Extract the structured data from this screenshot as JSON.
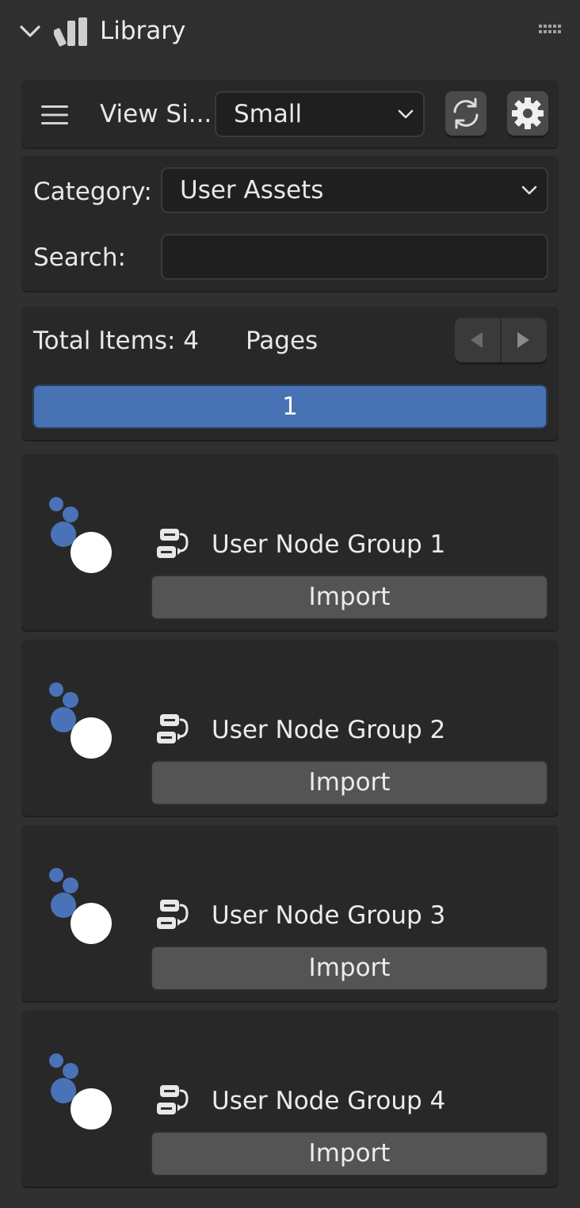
{
  "panel": {
    "title": "Library"
  },
  "toolbar": {
    "view_size_label": "View Si...",
    "view_size_value": "Small"
  },
  "filters": {
    "category_label": "Category:",
    "category_value": "User Assets",
    "search_label": "Search:",
    "search_value": ""
  },
  "pagination": {
    "total_label": "Total Items: 4",
    "pages_label": "Pages",
    "current_page": "1"
  },
  "items": [
    {
      "name": "User Node Group 1",
      "import_label": "Import"
    },
    {
      "name": "User Node Group 2",
      "import_label": "Import"
    },
    {
      "name": "User Node Group 3",
      "import_label": "Import"
    },
    {
      "name": "User Node Group 4",
      "import_label": "Import"
    }
  ],
  "icons": {
    "collapse": "chevron-down-icon",
    "library": "library-icon",
    "drag": "drag-handle-icon",
    "menu": "hamburger-menu-icon",
    "refresh": "refresh-icon",
    "settings": "gear-icon",
    "prev": "triangle-left-icon",
    "next": "triangle-right-icon",
    "node_group": "node-group-icon"
  },
  "colors": {
    "accent": "#4772b3",
    "thumb_blue": "#4a72b8",
    "panel_bg": "#303030",
    "box_bg": "#282828"
  }
}
